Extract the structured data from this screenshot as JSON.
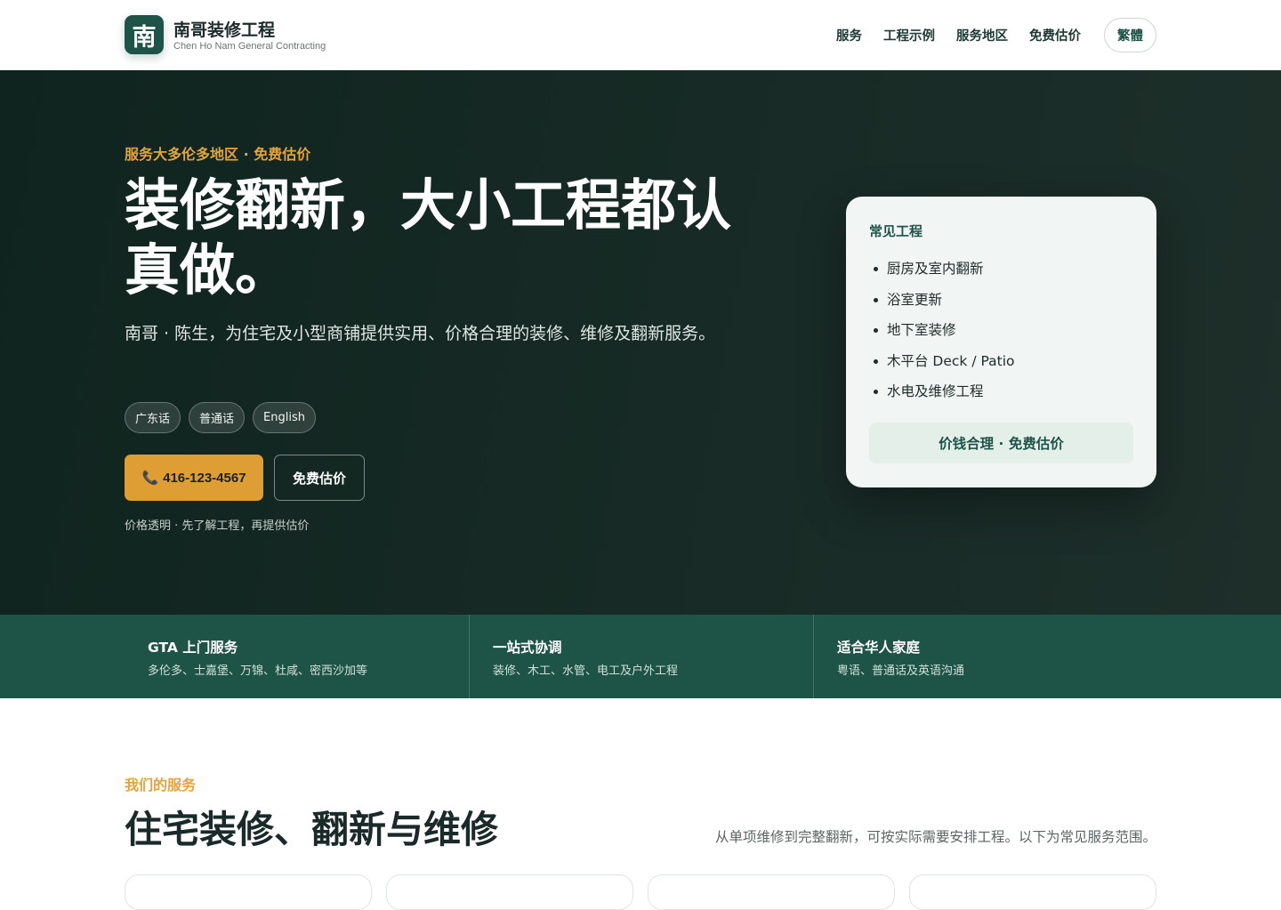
{
  "header": {
    "logo_char": "南",
    "brand_name": "南哥装修工程",
    "brand_sub": "Chen Ho Nam General Contracting",
    "nav": [
      "服务",
      "工程示例",
      "服务地区",
      "免费估价"
    ],
    "lang_toggle": "繁體"
  },
  "hero": {
    "eyebrow": "服务大多伦多地区 · 免费估价",
    "headline": "装修翻新，大小工程都认真做。",
    "subtitle": "南哥 · 陈生，为住宅及小型商铺提供实用、价格合理的装修、维修及翻新服务。",
    "languages": [
      "广东话",
      "普通话",
      "English"
    ],
    "phone_icon": "📞",
    "phone": "416-123-4567",
    "quote_button": "免费估价",
    "note": "价格透明 · 先了解工程，再提供估价"
  },
  "card": {
    "title": "常见工程",
    "items": [
      "厨房及室内翻新",
      "浴室更新",
      "地下室装修",
      "木平台 Deck / Patio",
      "水电及维修工程"
    ],
    "footer": "价钱合理 · 免费估价"
  },
  "features": [
    {
      "title": "GTA 上门服务",
      "desc": "多伦多、士嘉堡、万锦、杜咸、密西沙加等"
    },
    {
      "title": "一站式协调",
      "desc": "装修、木工、水管、电工及户外工程"
    },
    {
      "title": "适合华人家庭",
      "desc": "粤语、普通话及英语沟通"
    }
  ],
  "services": {
    "eyebrow": "我们的服务",
    "title": "住宅装修、翻新与维修",
    "desc": "从单项维修到完整翻新，可按实际需要安排工程。以下为常见服务范围。"
  },
  "colors": {
    "brand_green": "#1d5447",
    "accent_gold": "#de9e33",
    "hero_bg": "#132722"
  }
}
